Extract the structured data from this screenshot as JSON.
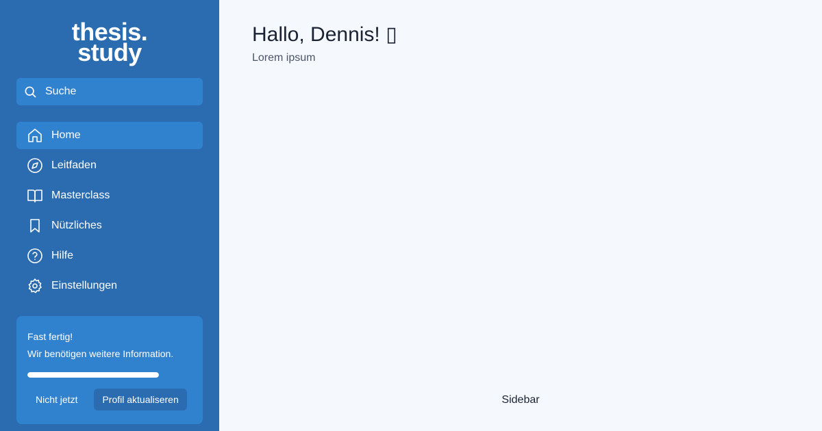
{
  "sidebar": {
    "logo_line1": "thesis.",
    "logo_line2": "study",
    "search": {
      "label": "Suche",
      "icon": "search-icon"
    },
    "items": [
      {
        "label": "Home",
        "icon": "home-icon",
        "active": true
      },
      {
        "label": "Leitfaden",
        "icon": "compass-icon"
      },
      {
        "label": "Masterclass",
        "icon": "book-open-icon"
      },
      {
        "label": "Nützliches",
        "icon": "bookmark-icon"
      },
      {
        "label": "Hilfe",
        "icon": "help-circle-icon"
      },
      {
        "label": "Einstellungen",
        "icon": "gear-icon"
      }
    ],
    "card": {
      "title": "Fast fertig!",
      "text": "Wir benötigen weitere Information.",
      "progress": 1.0,
      "dismiss_label": "Nicht jetzt",
      "action_label": "Profil aktualiseren"
    }
  },
  "main": {
    "greeting": "Hallo, Dennis! ▯",
    "subtitle": "Lorem ipsum",
    "footer_label": "Sidebar"
  },
  "colors": {
    "sidebar_bg": "#2b6cb0",
    "active_bg": "#3182ce",
    "main_bg": "#f5f9fd"
  }
}
